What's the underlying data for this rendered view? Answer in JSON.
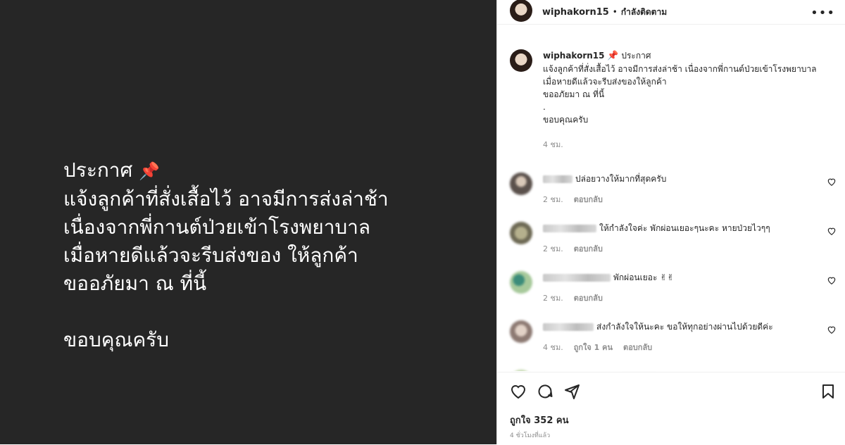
{
  "media": {
    "lines": [
      "ประกาศ",
      "แจ้งลูกค้าที่สั่งเสื้อไว้ อาจมีการส่งล่าช้า",
      "เนื่องจากพี่กานต์ป่วยเข้าโรงพยาบาล",
      "เมื่อหายดีแล้วจะรีบส่งของ ให้ลูกค้า",
      "ขออภัยมา ณ ที่นี้",
      "",
      "ขอบคุณครับ"
    ],
    "pin_emoji": "📌"
  },
  "header": {
    "username": "wiphakorn15",
    "separator": "•",
    "follow_status": "กำลังติดตาม",
    "more_icon": "more-horizontal-icon"
  },
  "caption": {
    "username": "wiphakorn15",
    "pin_emoji": "📌",
    "first_line": "ประกาศ",
    "text": "แจ้งลูกค้าที่สั่งเสื้อไว้ อาจมีการส่งล่าช้า เนื่องจากพี่กานต์ป่วยเข้าโรงพยาบาล เมื่อหายดีแล้วจะรีบส่งของให้ลูกค้า\nขออภัยมา ณ ที่นี้\n.\nขอบคุณครับ",
    "time": "4 ชม."
  },
  "comments": [
    {
      "text": "ปล่อยวางให้มากที่สุดครับ",
      "time": "2 ชม.",
      "likes": "",
      "reply": "ตอบกลับ"
    },
    {
      "text": "ให้กำลังใจค่ะ พักผ่อนเยอะๆนะคะ หายป่วยไวๆๆ",
      "time": "2 ชม.",
      "likes": "",
      "reply": "ตอบกลับ"
    },
    {
      "text": "พักผ่อนเยอะ ✌✌",
      "time": "2 ชม.",
      "likes": "",
      "reply": "ตอบกลับ"
    },
    {
      "text": "ส่งกำลังใจให้นะคะ ขอให้ทุกอย่างผ่านไปด้วยดีค่ะ",
      "time": "4 ชม.",
      "likes": "ถูกใจ 1 คน",
      "reply": "ตอบกลับ"
    }
  ],
  "actions": {
    "like_icon": "heart-icon",
    "comment_icon": "comment-icon",
    "share_icon": "send-icon",
    "save_icon": "bookmark-icon",
    "likes": "ถูกใจ 352 คน",
    "time_ago": "4 ชั่วโมงที่แล้ว"
  }
}
